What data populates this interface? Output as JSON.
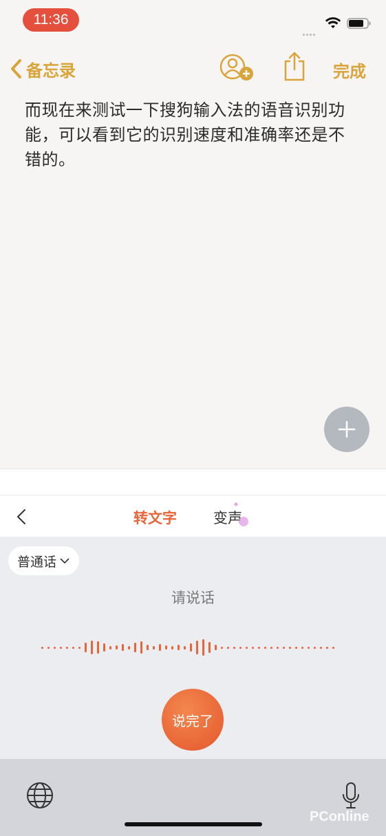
{
  "status_bar": {
    "time": "11:36"
  },
  "nav": {
    "back_label": "备忘录",
    "done_label": "完成"
  },
  "note": {
    "text": "而现在来测试一下搜狗输入法的语音识别功能，可以看到它的识别速度和准确率还是不错的。"
  },
  "keyboard": {
    "tabs": [
      {
        "label": "转文字",
        "active": true
      },
      {
        "label": "变声",
        "active": false
      }
    ],
    "language": "普通话",
    "prompt": "请说话",
    "finish_button": "说完了",
    "accent_color": "#e8653a"
  },
  "watermark": "PConline"
}
